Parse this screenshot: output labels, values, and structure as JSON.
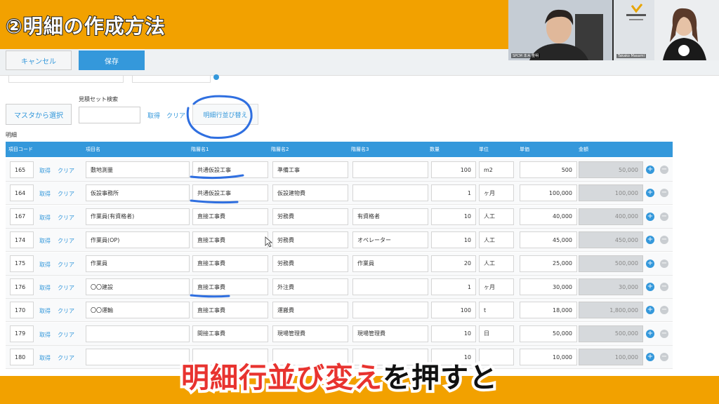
{
  "banner": {
    "title": "②明細の作成方法"
  },
  "webcam": {
    "left_label": "SPCM 本木 重明",
    "right_label": "Takako Masami"
  },
  "toolbar": {
    "cancel": "キャンセル",
    "save": "保存"
  },
  "form": {
    "master_select": "マスタから選択",
    "set_search_label": "見積セット検索",
    "get": "取得",
    "clear": "クリア",
    "reorder": "明細行並び替え",
    "section_label": "明細"
  },
  "table": {
    "headers": [
      "項目コード",
      "項目名",
      "階層名1",
      "階層名2",
      "階層名3",
      "数量",
      "単位",
      "単価",
      "金額"
    ],
    "get_label": "取得",
    "clear_label": "クリア",
    "rows": [
      {
        "code": "165",
        "name": "敷地測量",
        "lvl1": "共通仮設工事",
        "lvl2": "準備工事",
        "lvl3": "",
        "qty": "100",
        "unit": "m2",
        "price": "500",
        "amount": "50,000"
      },
      {
        "code": "164",
        "name": "仮設事務所",
        "lvl1": "共通仮設工事",
        "lvl2": "仮設建物費",
        "lvl3": "",
        "qty": "1",
        "unit": "ヶ月",
        "price": "100,000",
        "amount": "100,000"
      },
      {
        "code": "167",
        "name": "作業員(有資格者)",
        "lvl1": "直接工事費",
        "lvl2": "労務費",
        "lvl3": "有資格者",
        "qty": "10",
        "unit": "人工",
        "price": "40,000",
        "amount": "400,000"
      },
      {
        "code": "174",
        "name": "作業員(OP)",
        "lvl1": "直接工事費",
        "lvl2": "労務費",
        "lvl3": "オペレーター",
        "qty": "10",
        "unit": "人工",
        "price": "45,000",
        "amount": "450,000"
      },
      {
        "code": "175",
        "name": "作業員",
        "lvl1": "直接工事費",
        "lvl2": "労務費",
        "lvl3": "作業員",
        "qty": "20",
        "unit": "人工",
        "price": "25,000",
        "amount": "500,000"
      },
      {
        "code": "176",
        "name": "〇〇建設",
        "lvl1": "直接工事費",
        "lvl2": "外注費",
        "lvl3": "",
        "qty": "1",
        "unit": "ヶ月",
        "price": "30,000",
        "amount": "30,000"
      },
      {
        "code": "170",
        "name": "〇〇運輸",
        "lvl1": "直接工事費",
        "lvl2": "運搬費",
        "lvl3": "",
        "qty": "100",
        "unit": "t",
        "price": "18,000",
        "amount": "1,800,000"
      },
      {
        "code": "179",
        "name": "",
        "lvl1": "間接工事費",
        "lvl2": "現場管理費",
        "lvl3": "現場管理費",
        "qty": "10",
        "unit": "日",
        "price": "50,000",
        "amount": "500,000"
      },
      {
        "code": "180",
        "name": "",
        "lvl1": "",
        "lvl2": "",
        "lvl3": "",
        "qty": "10",
        "unit": "",
        "price": "10,000",
        "amount": "100,000"
      }
    ]
  },
  "caption": {
    "highlight": "明細行並び変え",
    "rest": "を押すと"
  },
  "colors": {
    "accent": "#3498db",
    "banner": "#f2a100",
    "annotation": "#2f6fe0",
    "caption_red": "#e8332f"
  }
}
